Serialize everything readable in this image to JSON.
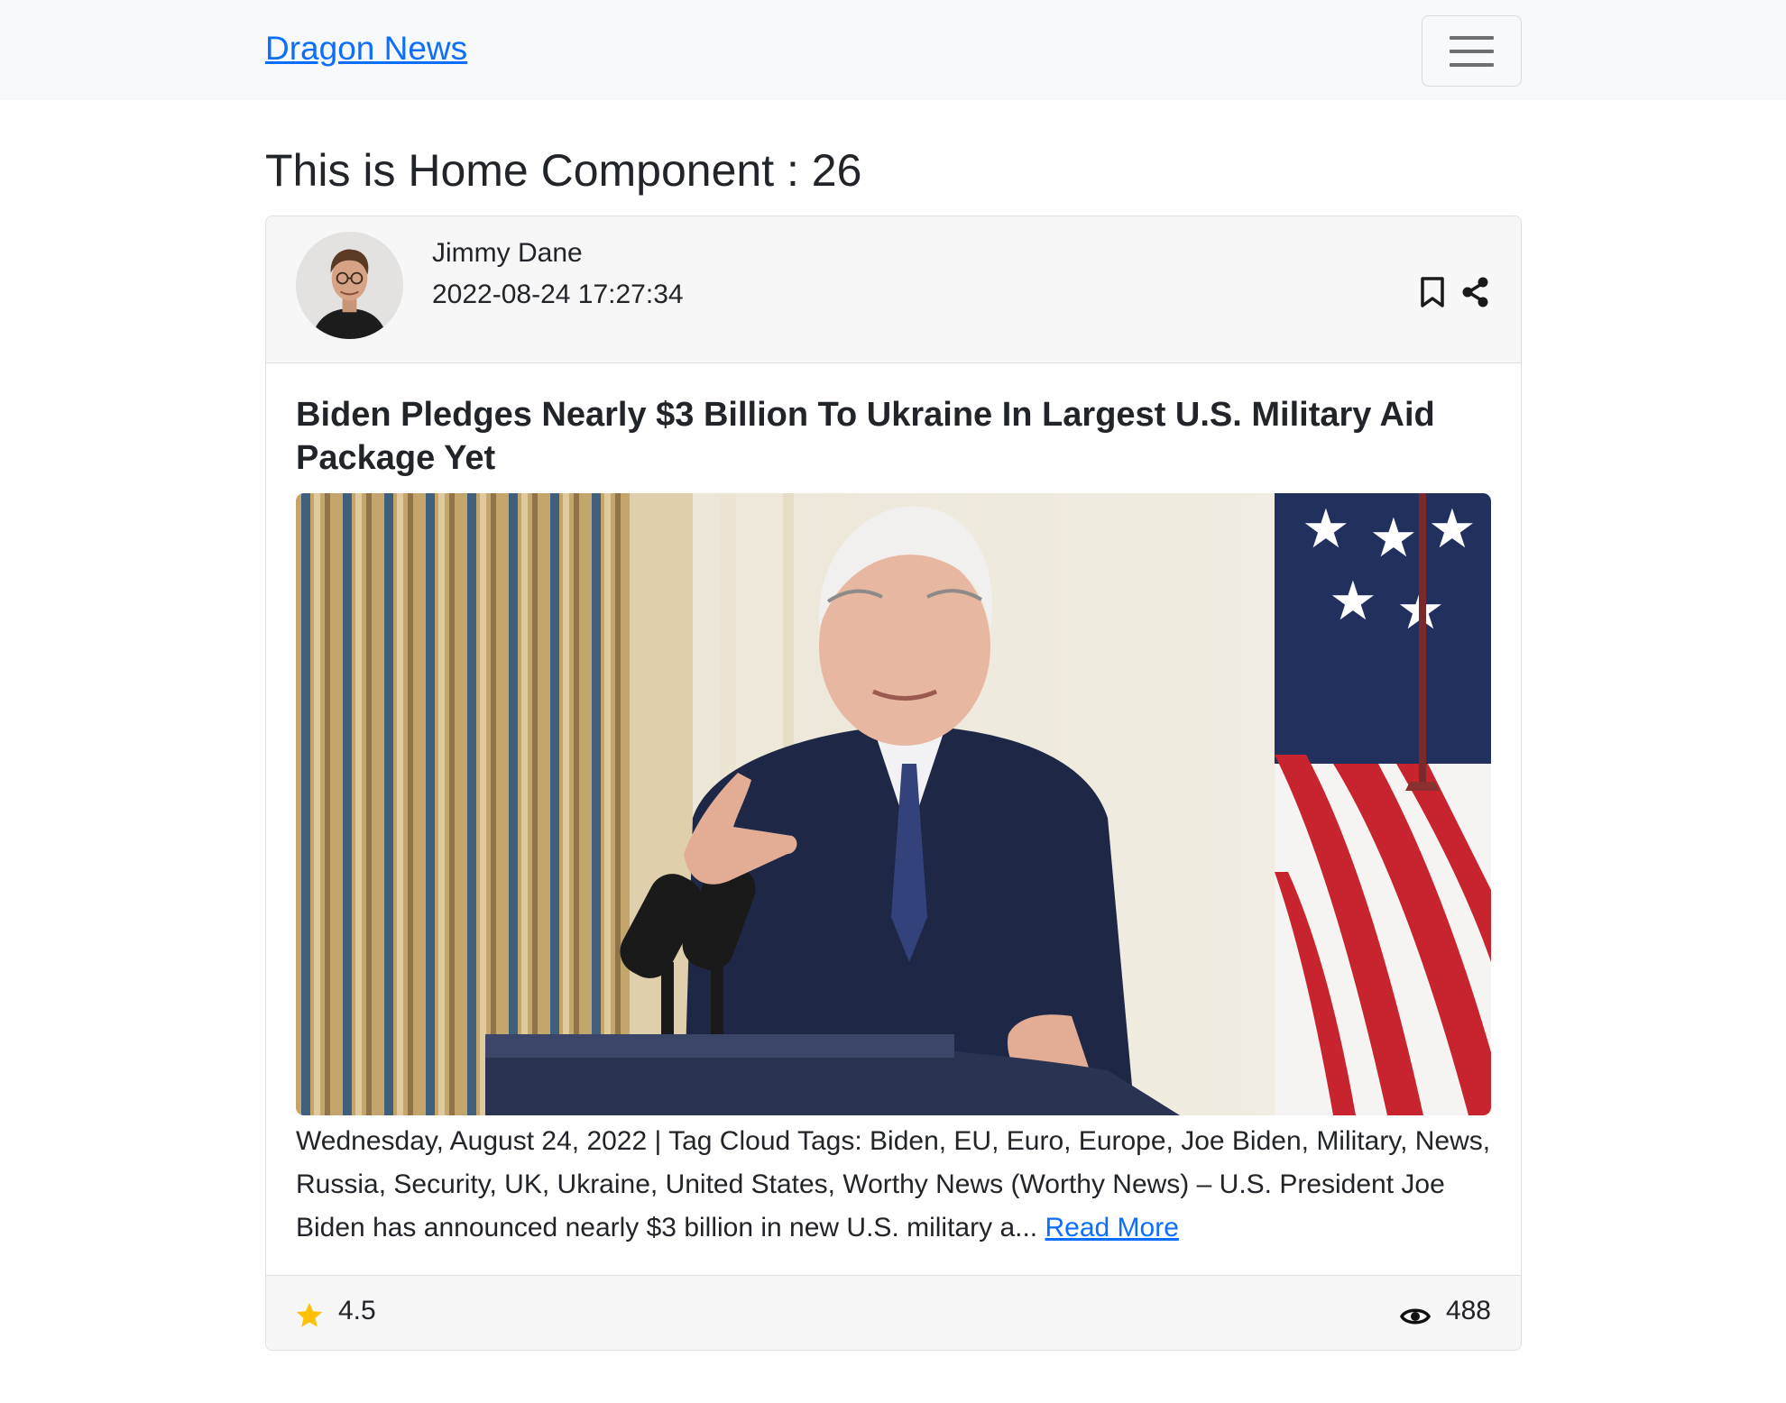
{
  "navbar": {
    "brand": "Dragon News",
    "toggler_icon": "hamburger-menu-icon"
  },
  "page": {
    "heading": "This is Home Component : 26"
  },
  "news_card": {
    "author": {
      "name": "Jimmy Dane",
      "published_date": "2022-08-24 17:27:34"
    },
    "actions": {
      "bookmark_icon": "bookmark-icon",
      "share_icon": "share-icon"
    },
    "title": "Biden Pledges Nearly $3 Billion To Ukraine In Largest U.S. Military Aid Package Yet",
    "details": "Wednesday, August 24, 2022 | Tag Cloud Tags: Biden, EU, Euro, Europe, Joe Biden, Military, News, Russia, Security, UK, Ukraine, United States, Worthy News (Worthy News) – U.S. President Joe Biden has announced nearly $3 billion in new U.S. military a...",
    "read_more": "Read More",
    "rating": "4.5",
    "views": "488",
    "colors": {
      "link": "#0d6efd",
      "star": "#ffc107",
      "header_bg": "#f7f7f7"
    }
  }
}
